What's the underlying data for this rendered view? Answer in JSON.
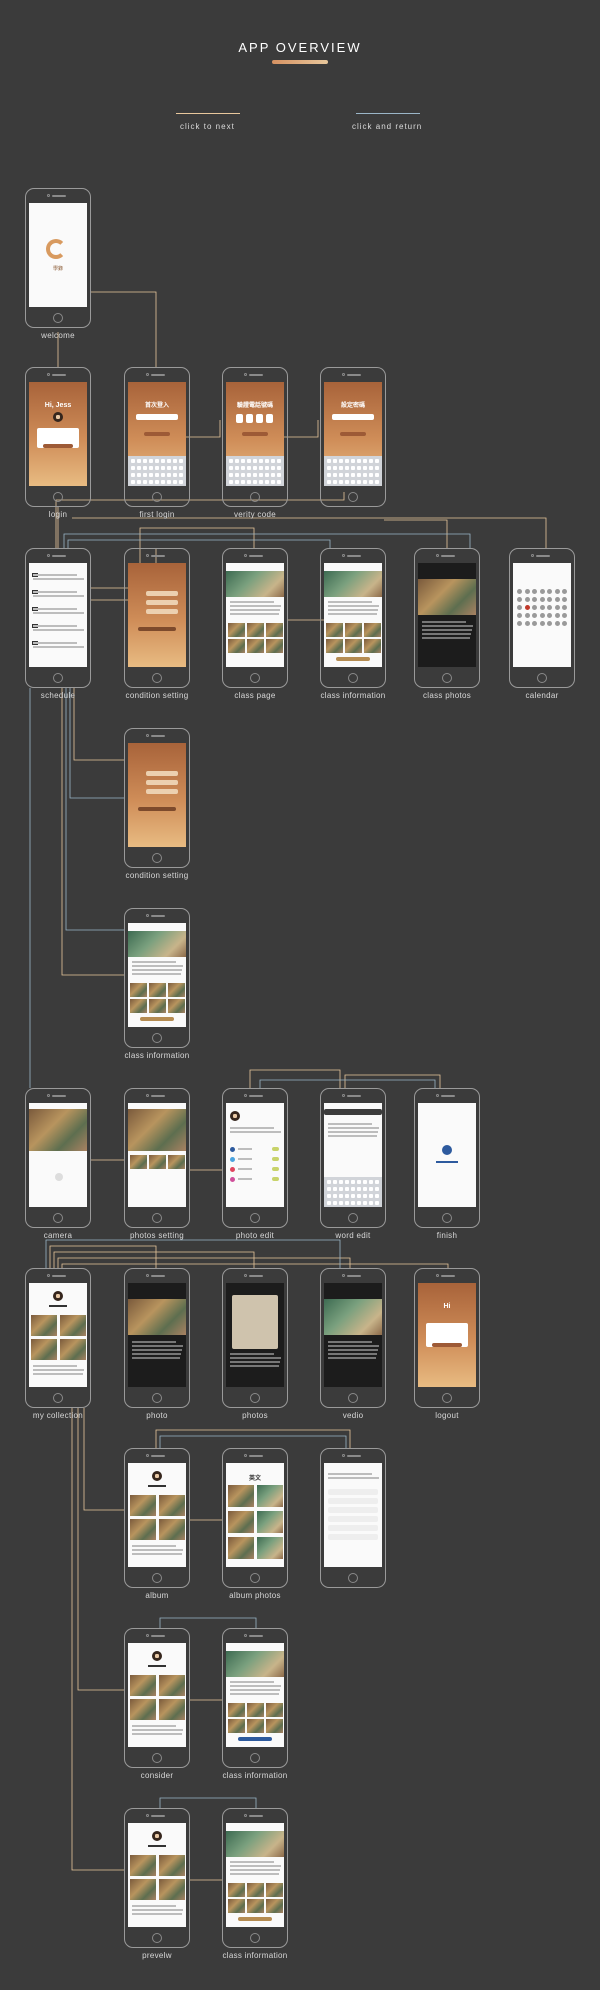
{
  "header": {
    "title": "APP OVERVIEW",
    "accent_gradient": [
      "#d69262",
      "#e8c79c"
    ]
  },
  "legend": {
    "next_label": "click to next",
    "return_label": "click and return",
    "next_color": "#e8c79c",
    "return_color": "#9bb6c8"
  },
  "welcome_screen": {
    "brand_text": "學錄"
  },
  "login_screen": {
    "greeting": "Hi, Jess"
  },
  "first_login_screen": {
    "heading": "首次登入"
  },
  "verify_screen": {
    "heading": "驗證電話號碼"
  },
  "password_screen": {
    "heading": "設定密碼"
  },
  "logout_screen": {
    "greeting": "Hi"
  },
  "album_photos_screen": {
    "subject": "英文"
  },
  "screens": [
    {
      "id": "welcome",
      "caption": "welcome",
      "style": "white"
    },
    {
      "id": "login",
      "caption": "login",
      "style": "grad"
    },
    {
      "id": "first_login",
      "caption": "first login",
      "style": "grad"
    },
    {
      "id": "verity_code",
      "caption": "verity code",
      "style": "grad"
    },
    {
      "id": "set_password",
      "caption": "",
      "style": "grad"
    },
    {
      "id": "schedule",
      "caption": "schedule",
      "style": "white"
    },
    {
      "id": "condition_setting_1",
      "caption": "condition setting",
      "style": "grad"
    },
    {
      "id": "class_page",
      "caption": "class page",
      "style": "white"
    },
    {
      "id": "class_information_1",
      "caption": "class information",
      "style": "white"
    },
    {
      "id": "class_photos",
      "caption": "class photos",
      "style": "dark"
    },
    {
      "id": "calendar",
      "caption": "calendar",
      "style": "white"
    },
    {
      "id": "condition_setting_2",
      "caption": "condition setting",
      "style": "grad"
    },
    {
      "id": "class_information_2",
      "caption": "class information",
      "style": "white"
    },
    {
      "id": "camera",
      "caption": "camera",
      "style": "white"
    },
    {
      "id": "photos_setting",
      "caption": "photos setting",
      "style": "white"
    },
    {
      "id": "photo_edit",
      "caption": "photo edit",
      "style": "white"
    },
    {
      "id": "word_edit",
      "caption": "word edit",
      "style": "white"
    },
    {
      "id": "finish",
      "caption": "finish",
      "style": "white"
    },
    {
      "id": "my_collection",
      "caption": "my collection",
      "style": "white"
    },
    {
      "id": "photo",
      "caption": "photo",
      "style": "dark"
    },
    {
      "id": "photos",
      "caption": "photos",
      "style": "dark"
    },
    {
      "id": "vedio",
      "caption": "vedio",
      "style": "dark"
    },
    {
      "id": "logout",
      "caption": "logout",
      "style": "grad"
    },
    {
      "id": "album",
      "caption": "album",
      "style": "white"
    },
    {
      "id": "album_photos",
      "caption": "album photos",
      "style": "white"
    },
    {
      "id": "album_menu",
      "caption": "",
      "style": "white"
    },
    {
      "id": "consider",
      "caption": "consider",
      "style": "white"
    },
    {
      "id": "class_information_3",
      "caption": "class information",
      "style": "white"
    },
    {
      "id": "prevelw",
      "caption": "prevelw",
      "style": "white"
    },
    {
      "id": "class_information_4",
      "caption": "class information",
      "style": "white"
    }
  ]
}
